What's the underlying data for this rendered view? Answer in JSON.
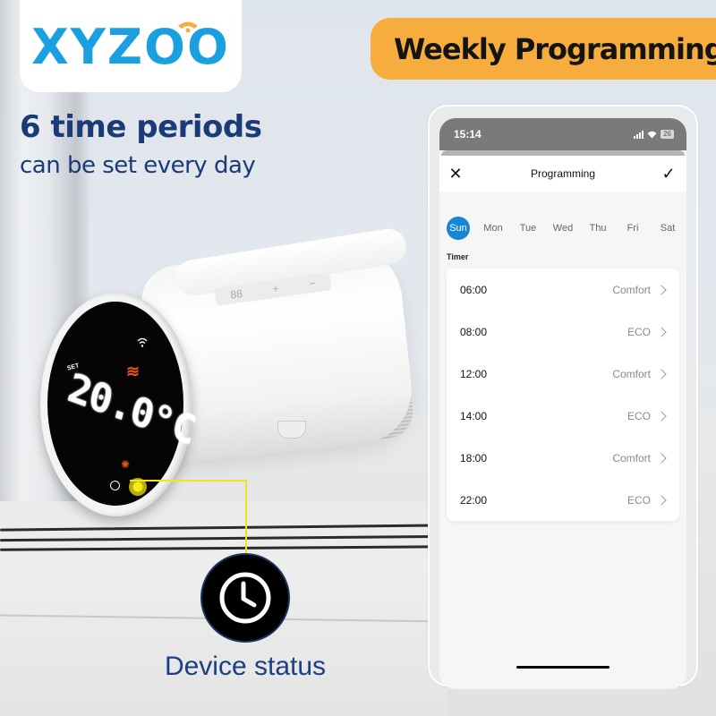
{
  "brand": {
    "logo_text": "XYZOO",
    "logo_color": "#1a9fe0",
    "logo_accent_color": "#f6ad3d"
  },
  "headline": {
    "line1": "6 time periods",
    "line2": "can be set every day",
    "color": "#1a3a78"
  },
  "banner": {
    "title": "Weekly Programming",
    "background": "#f6ad3d"
  },
  "device": {
    "screen_label_set": "SET",
    "temperature": "20.0°C",
    "icons": [
      "wifi-icon",
      "heating-icon",
      "sun-icon",
      "clock-icon"
    ],
    "buttons": [
      "88",
      "+",
      "−"
    ]
  },
  "callout": {
    "icon": "clock-icon",
    "label": "Device status",
    "line_color": "#efe518"
  },
  "phone": {
    "status_bar": {
      "time": "15:14",
      "battery": "26"
    },
    "nav": {
      "close_icon": "✕",
      "title": "Programming",
      "confirm_icon": "✓"
    },
    "days": [
      {
        "label": "Sun",
        "active": true
      },
      {
        "label": "Mon",
        "active": false
      },
      {
        "label": "Tue",
        "active": false
      },
      {
        "label": "Wed",
        "active": false
      },
      {
        "label": "Thu",
        "active": false
      },
      {
        "label": "Fri",
        "active": false
      },
      {
        "label": "Sat",
        "active": false
      }
    ],
    "timer_label": "Timer",
    "timers": [
      {
        "time": "06:00",
        "mode": "Comfort"
      },
      {
        "time": "08:00",
        "mode": "ECO"
      },
      {
        "time": "12:00",
        "mode": "Comfort"
      },
      {
        "time": "14:00",
        "mode": "ECO"
      },
      {
        "time": "18:00",
        "mode": "Comfort"
      },
      {
        "time": "22:00",
        "mode": "ECO"
      }
    ],
    "accent_color": "#1587d6"
  }
}
